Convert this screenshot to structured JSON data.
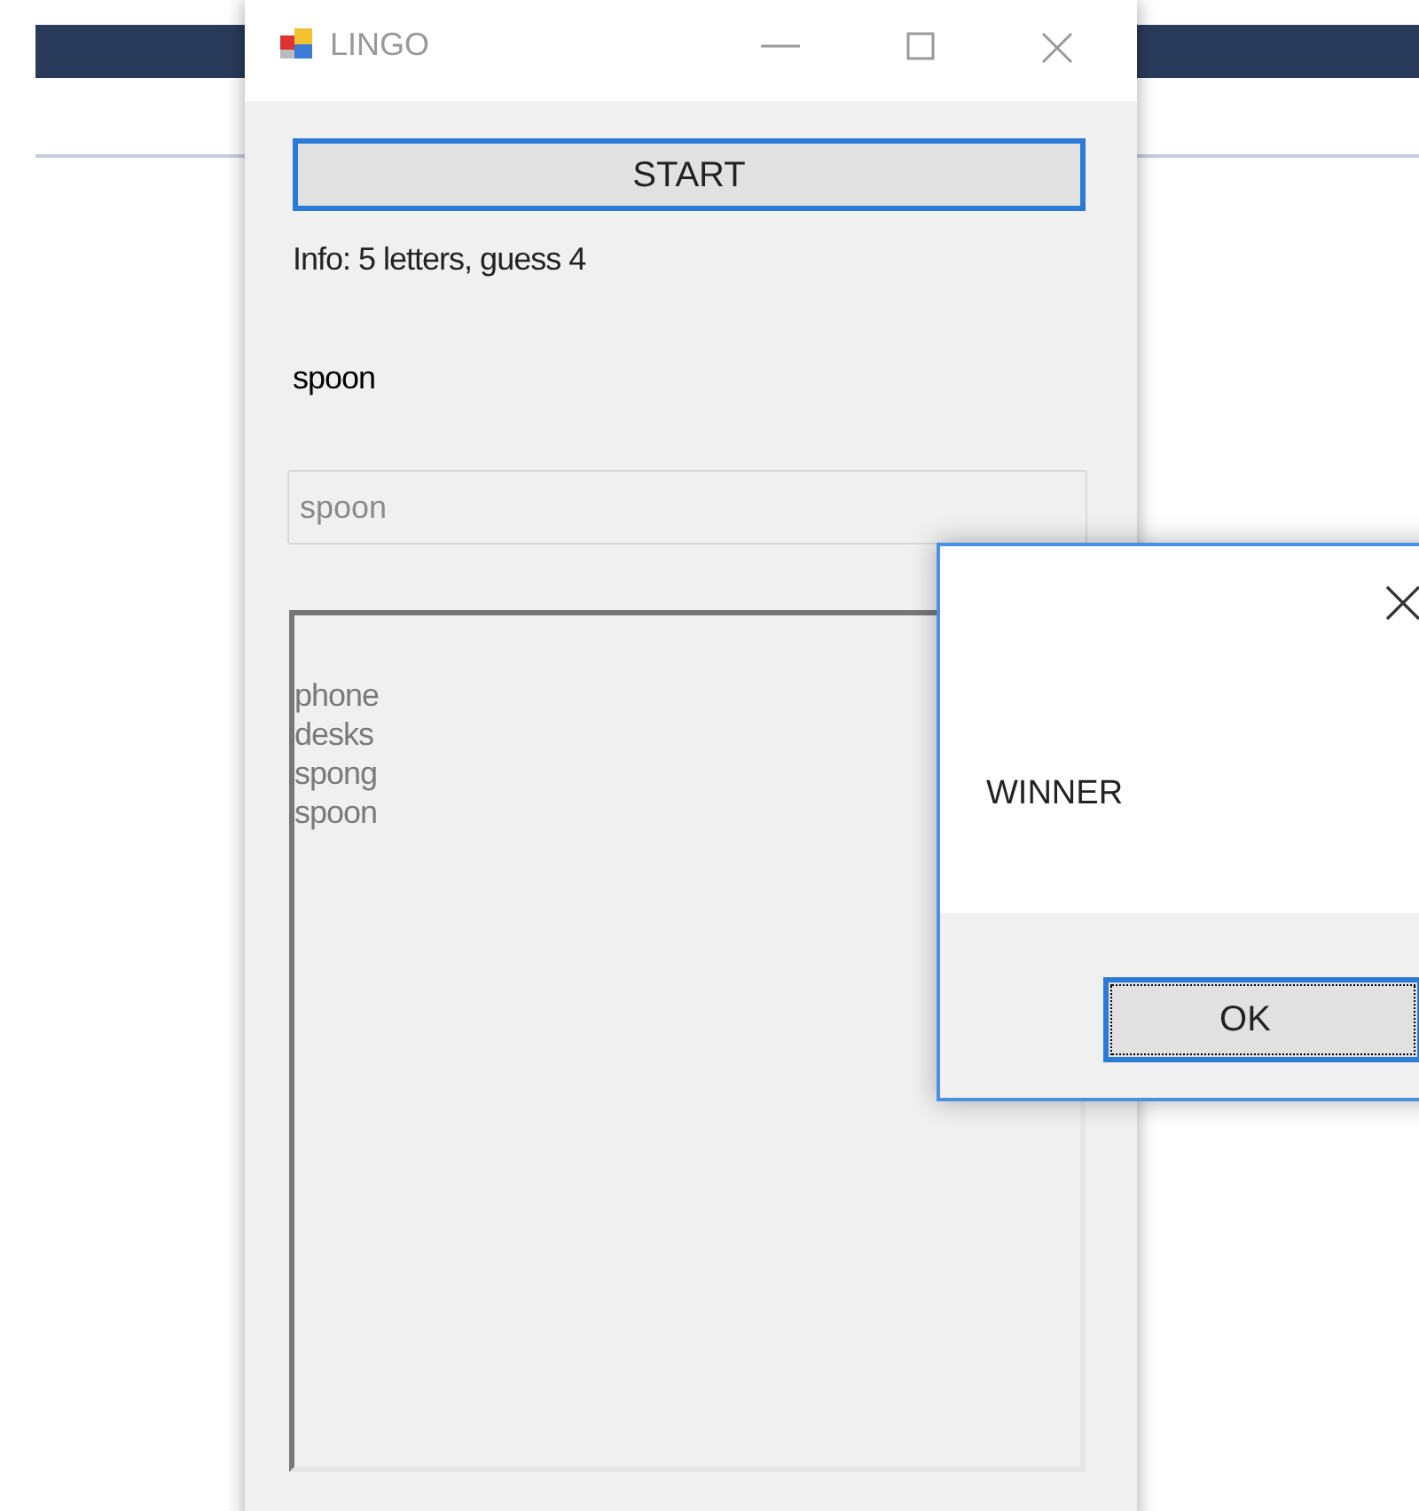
{
  "window": {
    "title": "LINGO"
  },
  "start_button": {
    "label": "START",
    "focused": true
  },
  "info": "Info: 5 letters, guess 4",
  "word": "spoon",
  "guess_field": {
    "value": "spoon",
    "disabled": true
  },
  "guesses": {
    "disabled": true,
    "items": [
      "phone",
      "desks",
      "spong",
      "spoon"
    ]
  },
  "dialog": {
    "message": "WINNER",
    "ok_button": {
      "label": "OK",
      "focused": true
    }
  }
}
